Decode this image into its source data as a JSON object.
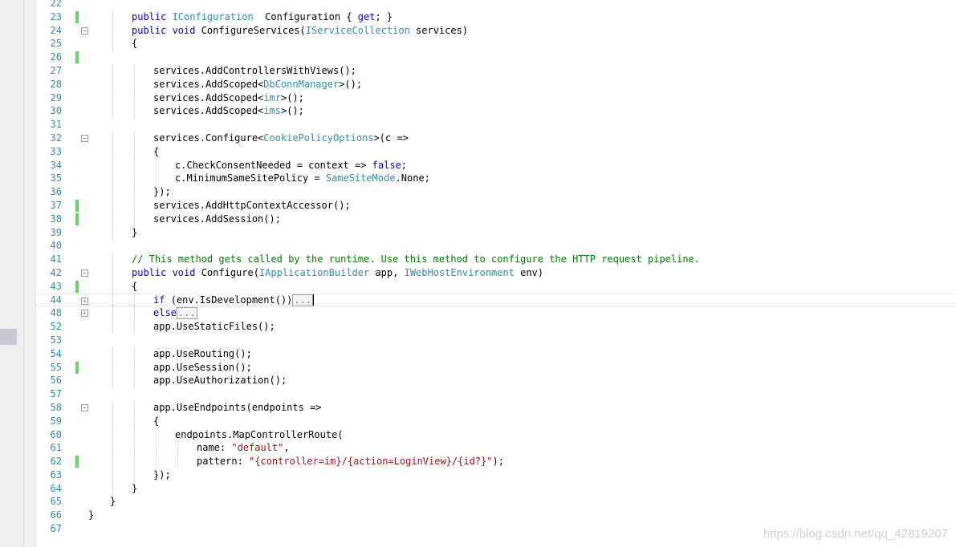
{
  "editor": {
    "lines": [
      {
        "n": "22",
        "indent": 0,
        "parts": []
      },
      {
        "n": "23",
        "indent": 2,
        "mark": true,
        "parts": [
          [
            "kw",
            "public "
          ],
          [
            "ty",
            "IConfiguration"
          ],
          [
            "",
            "  Configuration { "
          ],
          [
            "kw",
            "get"
          ],
          [
            "",
            "; }"
          ]
        ]
      },
      {
        "n": "24",
        "indent": 2,
        "fold": "minus",
        "parts": [
          [
            "kw",
            "public void "
          ],
          [
            "",
            "ConfigureServices("
          ],
          [
            "ty",
            "IServiceCollection"
          ],
          [
            "",
            " services)"
          ]
        ]
      },
      {
        "n": "25",
        "indent": 2,
        "parts": [
          [
            "",
            "{"
          ]
        ]
      },
      {
        "n": "26",
        "indent": 0,
        "mark": true,
        "parts": []
      },
      {
        "n": "27",
        "indent": 3,
        "parts": [
          [
            "",
            "services.AddControllersWithViews();"
          ]
        ]
      },
      {
        "n": "28",
        "indent": 3,
        "parts": [
          [
            "",
            "services.AddScoped<"
          ],
          [
            "ty",
            "DbConnManager"
          ],
          [
            "",
            ">();"
          ]
        ]
      },
      {
        "n": "29",
        "indent": 3,
        "parts": [
          [
            "",
            "services.AddScoped<"
          ],
          [
            "ty",
            "imr"
          ],
          [
            "",
            ">();"
          ]
        ]
      },
      {
        "n": "30",
        "indent": 3,
        "parts": [
          [
            "",
            "services.AddScoped<"
          ],
          [
            "ty",
            "ims"
          ],
          [
            "",
            ">();"
          ]
        ]
      },
      {
        "n": "31",
        "indent": 0,
        "parts": []
      },
      {
        "n": "32",
        "indent": 3,
        "fold": "minus",
        "parts": [
          [
            "",
            "services.Configure<"
          ],
          [
            "ty",
            "CookiePolicyOptions"
          ],
          [
            "",
            ">(c =>"
          ]
        ]
      },
      {
        "n": "33",
        "indent": 3,
        "parts": [
          [
            "",
            "{"
          ]
        ]
      },
      {
        "n": "34",
        "indent": 4,
        "parts": [
          [
            "",
            "c.CheckConsentNeeded = context => "
          ],
          [
            "kw",
            "false"
          ],
          [
            "",
            ";"
          ]
        ]
      },
      {
        "n": "35",
        "indent": 4,
        "parts": [
          [
            "",
            "c.MinimumSameSitePolicy = "
          ],
          [
            "ty",
            "SameSiteMode"
          ],
          [
            "",
            ".None;"
          ]
        ]
      },
      {
        "n": "36",
        "indent": 3,
        "parts": [
          [
            "",
            "});"
          ]
        ]
      },
      {
        "n": "37",
        "indent": 3,
        "mark": true,
        "parts": [
          [
            "",
            "services.AddHttpContextAccessor();"
          ]
        ]
      },
      {
        "n": "38",
        "indent": 3,
        "mark": true,
        "parts": [
          [
            "",
            "services.AddSession();"
          ]
        ]
      },
      {
        "n": "39",
        "indent": 2,
        "parts": [
          [
            "",
            "}"
          ]
        ]
      },
      {
        "n": "40",
        "indent": 0,
        "parts": []
      },
      {
        "n": "41",
        "indent": 2,
        "parts": [
          [
            "cm",
            "// This method gets called by the runtime. Use this method to configure the HTTP request pipeline."
          ]
        ]
      },
      {
        "n": "42",
        "indent": 2,
        "fold": "minus",
        "parts": [
          [
            "kw",
            "public void "
          ],
          [
            "",
            "Configure("
          ],
          [
            "ty",
            "IApplicationBuilder"
          ],
          [
            "",
            " app, "
          ],
          [
            "ty",
            "IWebHostEnvironment"
          ],
          [
            "",
            " env)"
          ]
        ]
      },
      {
        "n": "43",
        "indent": 2,
        "mark": true,
        "parts": [
          [
            "",
            "{"
          ]
        ]
      },
      {
        "n": "44",
        "indent": 3,
        "fold": "plus",
        "current": true,
        "parts": [
          [
            "kw",
            "if "
          ],
          [
            "",
            "(env.IsDevelopment())"
          ],
          [
            "collapsed",
            "..."
          ],
          [
            "cursor",
            ""
          ]
        ]
      },
      {
        "n": "48",
        "indent": 3,
        "fold": "plus",
        "parts": [
          [
            "kw",
            "else"
          ],
          [
            "collapsed",
            "..."
          ]
        ]
      },
      {
        "n": "52",
        "indent": 3,
        "parts": [
          [
            "",
            "app.UseStaticFiles();"
          ]
        ]
      },
      {
        "n": "53",
        "indent": 0,
        "parts": []
      },
      {
        "n": "54",
        "indent": 3,
        "parts": [
          [
            "",
            "app.UseRouting();"
          ]
        ]
      },
      {
        "n": "55",
        "indent": 3,
        "mark": true,
        "parts": [
          [
            "",
            "app.UseSession();"
          ]
        ]
      },
      {
        "n": "56",
        "indent": 3,
        "parts": [
          [
            "",
            "app.UseAuthorization();"
          ]
        ]
      },
      {
        "n": "57",
        "indent": 0,
        "parts": []
      },
      {
        "n": "58",
        "indent": 3,
        "fold": "minus",
        "parts": [
          [
            "",
            "app.UseEndpoints(endpoints =>"
          ]
        ]
      },
      {
        "n": "59",
        "indent": 3,
        "parts": [
          [
            "",
            "{"
          ]
        ]
      },
      {
        "n": "60",
        "indent": 4,
        "parts": [
          [
            "",
            "endpoints.MapControllerRoute("
          ]
        ]
      },
      {
        "n": "61",
        "indent": 5,
        "parts": [
          [
            "",
            "name: "
          ],
          [
            "str",
            "\"default\""
          ],
          [
            "",
            ","
          ]
        ]
      },
      {
        "n": "62",
        "indent": 5,
        "mark": true,
        "parts": [
          [
            "",
            "pattern: "
          ],
          [
            "str",
            "\"{controller=im}/{action=LoginView}/{id?}\""
          ],
          [
            "",
            ");"
          ]
        ]
      },
      {
        "n": "63",
        "indent": 3,
        "parts": [
          [
            "",
            "});"
          ]
        ]
      },
      {
        "n": "64",
        "indent": 2,
        "parts": [
          [
            "",
            "}"
          ]
        ]
      },
      {
        "n": "65",
        "indent": 1,
        "parts": [
          [
            "",
            "}"
          ]
        ]
      },
      {
        "n": "66",
        "indent": 0,
        "parts": [
          [
            "",
            "}"
          ]
        ]
      },
      {
        "n": "67",
        "indent": 0,
        "parts": []
      }
    ]
  },
  "watermark": "https://blog.csdn.net/qq_42819207"
}
